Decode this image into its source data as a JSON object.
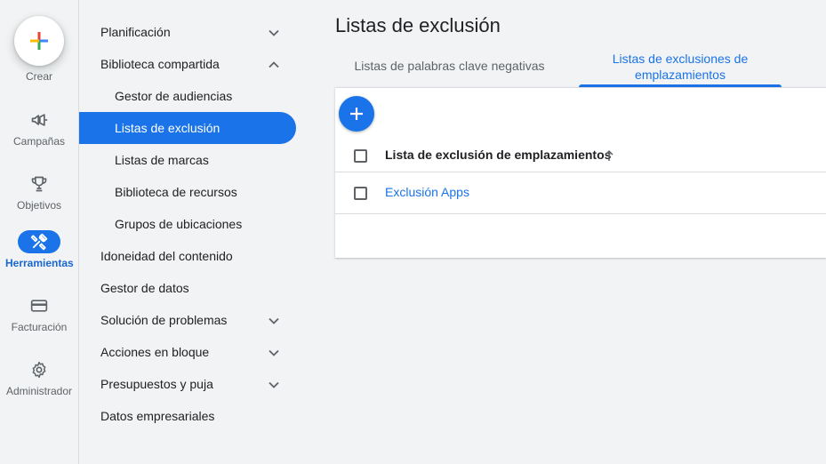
{
  "rail": {
    "create_label": "Crear",
    "items": [
      {
        "label": "Campañas",
        "icon": "megaphone-icon"
      },
      {
        "label": "Objetivos",
        "icon": "trophy-icon"
      },
      {
        "label": "Herramientas",
        "icon": "tools-icon",
        "active": true
      },
      {
        "label": "Facturación",
        "icon": "credit-card-icon"
      },
      {
        "label": "Administrador",
        "icon": "gear-icon"
      }
    ]
  },
  "nav": {
    "items": [
      {
        "label": "Planificación",
        "expandable": true,
        "expanded": false
      },
      {
        "label": "Biblioteca compartida",
        "expandable": true,
        "expanded": true
      },
      {
        "label": "Gestor de audiencias",
        "sub": true
      },
      {
        "label": "Listas de exclusión",
        "sub": true,
        "selected": true
      },
      {
        "label": "Listas de marcas",
        "sub": true
      },
      {
        "label": "Biblioteca de recursos",
        "sub": true
      },
      {
        "label": "Grupos de ubicaciones",
        "sub": true
      },
      {
        "label": "Idoneidad del contenido"
      },
      {
        "label": "Gestor de datos"
      },
      {
        "label": "Solución de problemas",
        "expandable": true,
        "expanded": false
      },
      {
        "label": "Acciones en bloque",
        "expandable": true,
        "expanded": false
      },
      {
        "label": "Presupuestos y puja",
        "expandable": true,
        "expanded": false
      },
      {
        "label": "Datos empresariales"
      }
    ]
  },
  "main": {
    "title": "Listas de exclusión",
    "tabs": [
      {
        "label": "Listas de palabras clave negativas",
        "active": false
      },
      {
        "label": "Listas de exclusiones de emplazamientos",
        "active": true
      }
    ],
    "table": {
      "column_header": "Lista de exclusión de emplazamientos",
      "sort": "ascending",
      "rows": [
        {
          "name": "Exclusión Apps"
        }
      ]
    }
  },
  "colors": {
    "accent": "#1a73e8",
    "background": "#f1f3f4"
  }
}
